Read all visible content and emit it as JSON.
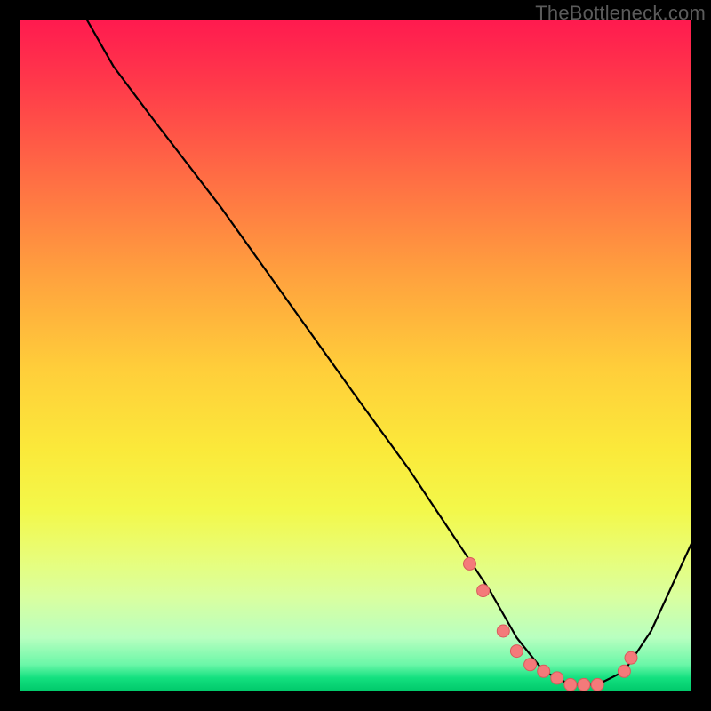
{
  "watermark": "TheBottleneck.com",
  "colors": {
    "background": "#000000",
    "line": "#000000",
    "marker_fill": "#f47a7a",
    "marker_stroke": "#d85c5c"
  },
  "chart_data": {
    "type": "line",
    "title": "",
    "xlabel": "",
    "ylabel": "",
    "xlim": [
      0,
      100
    ],
    "ylim": [
      0,
      100
    ],
    "x": [
      10,
      14,
      20,
      30,
      40,
      50,
      58,
      62,
      66,
      70,
      74,
      78,
      82,
      86,
      90,
      94,
      100
    ],
    "values": [
      100,
      93,
      85,
      72,
      58,
      44,
      33,
      27,
      21,
      15,
      8,
      3,
      1,
      1,
      3,
      9,
      22
    ],
    "markers": {
      "x": [
        67,
        69,
        72,
        74,
        76,
        78,
        80,
        82,
        84,
        86,
        90,
        91
      ],
      "y": [
        19,
        15,
        9,
        6,
        4,
        3,
        2,
        1,
        1,
        1,
        3,
        5
      ]
    }
  }
}
